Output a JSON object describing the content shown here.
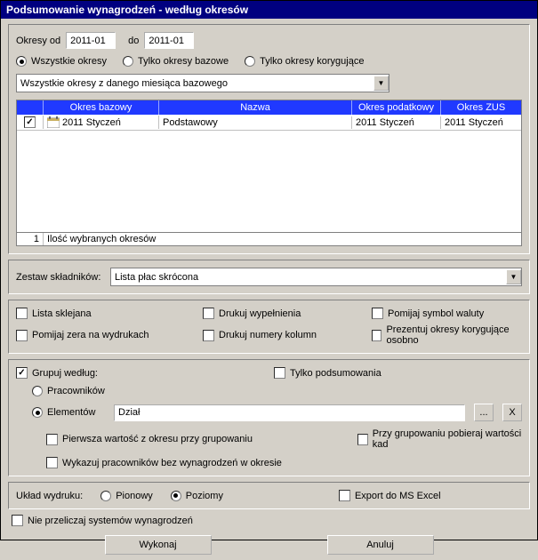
{
  "title": "Podsumowanie wynagrodzeń - według okresów",
  "periods": {
    "from_label": "Okresy od",
    "from_value": "2011-01",
    "to_label": "do",
    "to_value": "2011-01",
    "filter": {
      "all": "Wszystkie okresy",
      "base": "Tylko okresy bazowe",
      "corr": "Tylko okresy korygujące"
    },
    "scope_select": "Wszystkie okresy z danego miesiąca bazowego"
  },
  "table": {
    "headers": {
      "c0": "",
      "c1": "Okres bazowy",
      "c2": "Nazwa",
      "c3": "Okres podatkowy",
      "c4": "Okres ZUS"
    },
    "row": {
      "okres_bazowy": "2011 Styczeń",
      "nazwa": "Podstawowy",
      "okres_podatkowy": "2011 Styczeń",
      "okres_zus": "2011 Styczeń"
    },
    "footer": {
      "count": "1",
      "label": "Ilość wybranych okresów"
    }
  },
  "zestaw": {
    "label": "Zestaw składników:",
    "value": "Lista płac skrócona"
  },
  "options": {
    "lista_sklejana": "Lista sklejana",
    "drukuj_wypelnienia": "Drukuj wypełnienia",
    "pomijaj_symbol": "Pomijaj symbol waluty",
    "pomijaj_zera": "Pomijaj zera na wydrukach",
    "drukuj_numery": "Drukuj numery kolumn",
    "prezentuj_korygujace": "Prezentuj okresy korygujące osobno"
  },
  "group": {
    "grupuj_label": "Grupuj według:",
    "tylko_podsumowania": "Tylko podsumowania",
    "pracownikow": "Pracowników",
    "elementow": "Elementów",
    "element_value": "Dział",
    "dots": "...",
    "x": "X",
    "pierwsza": "Pierwsza wartość z okresu przy grupowaniu",
    "przy_grupowaniu": "Przy grupowaniu pobieraj wartości kad",
    "wykazuj": "Wykazuj pracowników bez wynagrodzeń w okresie"
  },
  "layout": {
    "label": "Układ wydruku:",
    "pionowy": "Pionowy",
    "poziomy": "Poziomy",
    "export": "Export do MS Excel"
  },
  "nie_przeliczaj": "Nie przeliczaj systemów wynagrodzeń",
  "buttons": {
    "wykonaj": "Wykonaj",
    "anuluj": "Anuluj"
  }
}
